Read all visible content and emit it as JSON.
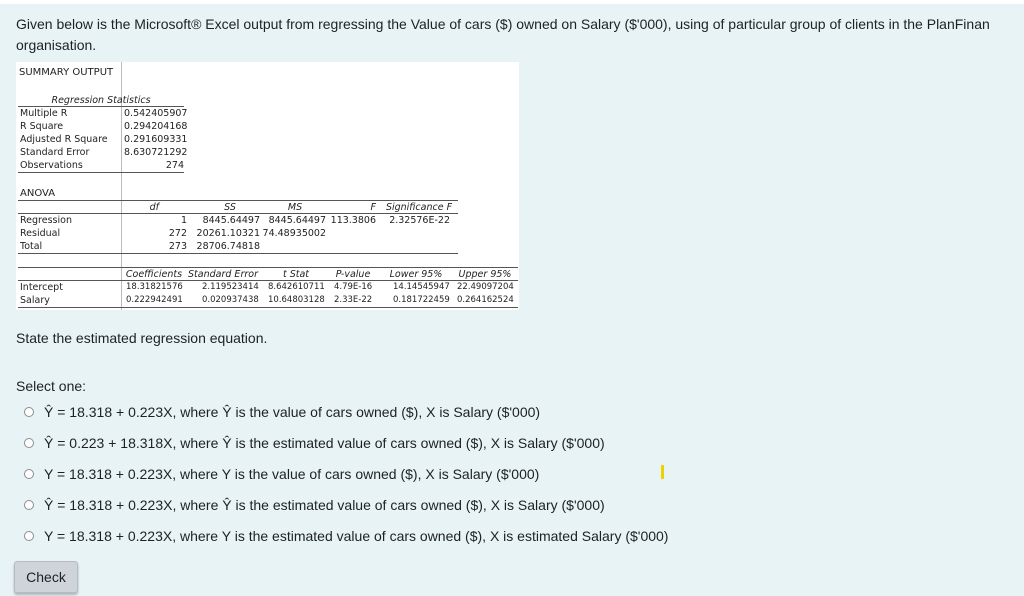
{
  "question": {
    "text": "Given below is the Microsoft® Excel output from regressing the Value of cars ($) owned on Salary ($'000), using of particular group of clients in the PlanFinan organisation.",
    "prompt": "State the estimated regression equation.",
    "select_label": "Select one:"
  },
  "excel": {
    "summary_title": "SUMMARY OUTPUT",
    "reg_stats_title": "Regression Statistics",
    "reg_stats": [
      {
        "label": "Multiple R",
        "value": "0.542405907"
      },
      {
        "label": "R Square",
        "value": "0.294204168"
      },
      {
        "label": "Adjusted R Square",
        "value": "0.291609331"
      },
      {
        "label": "Standard Error",
        "value": "8.630721292"
      },
      {
        "label": "Observations",
        "value": "274"
      }
    ],
    "anova_title": "ANOVA",
    "anova_headers": {
      "df": "df",
      "ss": "SS",
      "ms": "MS",
      "f": "F",
      "sigf": "Significance F"
    },
    "anova_rows": [
      {
        "label": "Regression",
        "df": "1",
        "ss": "8445.64497",
        "ms": "8445.64497",
        "f": "113.3806",
        "sigf": "2.32576E-22"
      },
      {
        "label": "Residual",
        "df": "272",
        "ss": "20261.10321",
        "ms": "74.48935002",
        "f": "",
        "sigf": ""
      },
      {
        "label": "Total",
        "df": "273",
        "ss": "28706.74818",
        "ms": "",
        "f": "",
        "sigf": ""
      }
    ],
    "coef_headers": {
      "coef": "Coefficients",
      "se": "Standard Error",
      "t": "t Stat",
      "p": "P-value",
      "lower": "Lower 95%",
      "upper": "Upper 95%"
    },
    "coef_rows": [
      {
        "label": "Intercept",
        "coef": "18.31821576",
        "se": "2.119523414",
        "t": "8.642610711",
        "p": "4.79E-16",
        "lower": "14.14545947",
        "upper": "22.49097204"
      },
      {
        "label": "Salary",
        "coef": "0.222942491",
        "se": "0.020937438",
        "t": "10.64803128",
        "p": "2.33E-22",
        "lower": "0.181722459",
        "upper": "0.264162524"
      }
    ]
  },
  "options": [
    "Ŷ = 18.318 + 0.223X, where Ŷ is the value of cars owned ($), X is Salary ($'000)",
    "Ŷ = 0.223 + 18.318X, where Ŷ is the estimated value of cars owned ($), X is Salary ($'000)",
    "Y = 18.318 + 0.223X, where Y is the value of cars owned ($), X is Salary ($'000)",
    "Ŷ = 18.318 + 0.223X, where Ŷ is the estimated value of cars owned ($), X is Salary ($'000)",
    "Y = 18.318 + 0.223X, where Y is the estimated value of cars owned ($), X is estimated Salary ($'000)"
  ],
  "check_label": "Check"
}
